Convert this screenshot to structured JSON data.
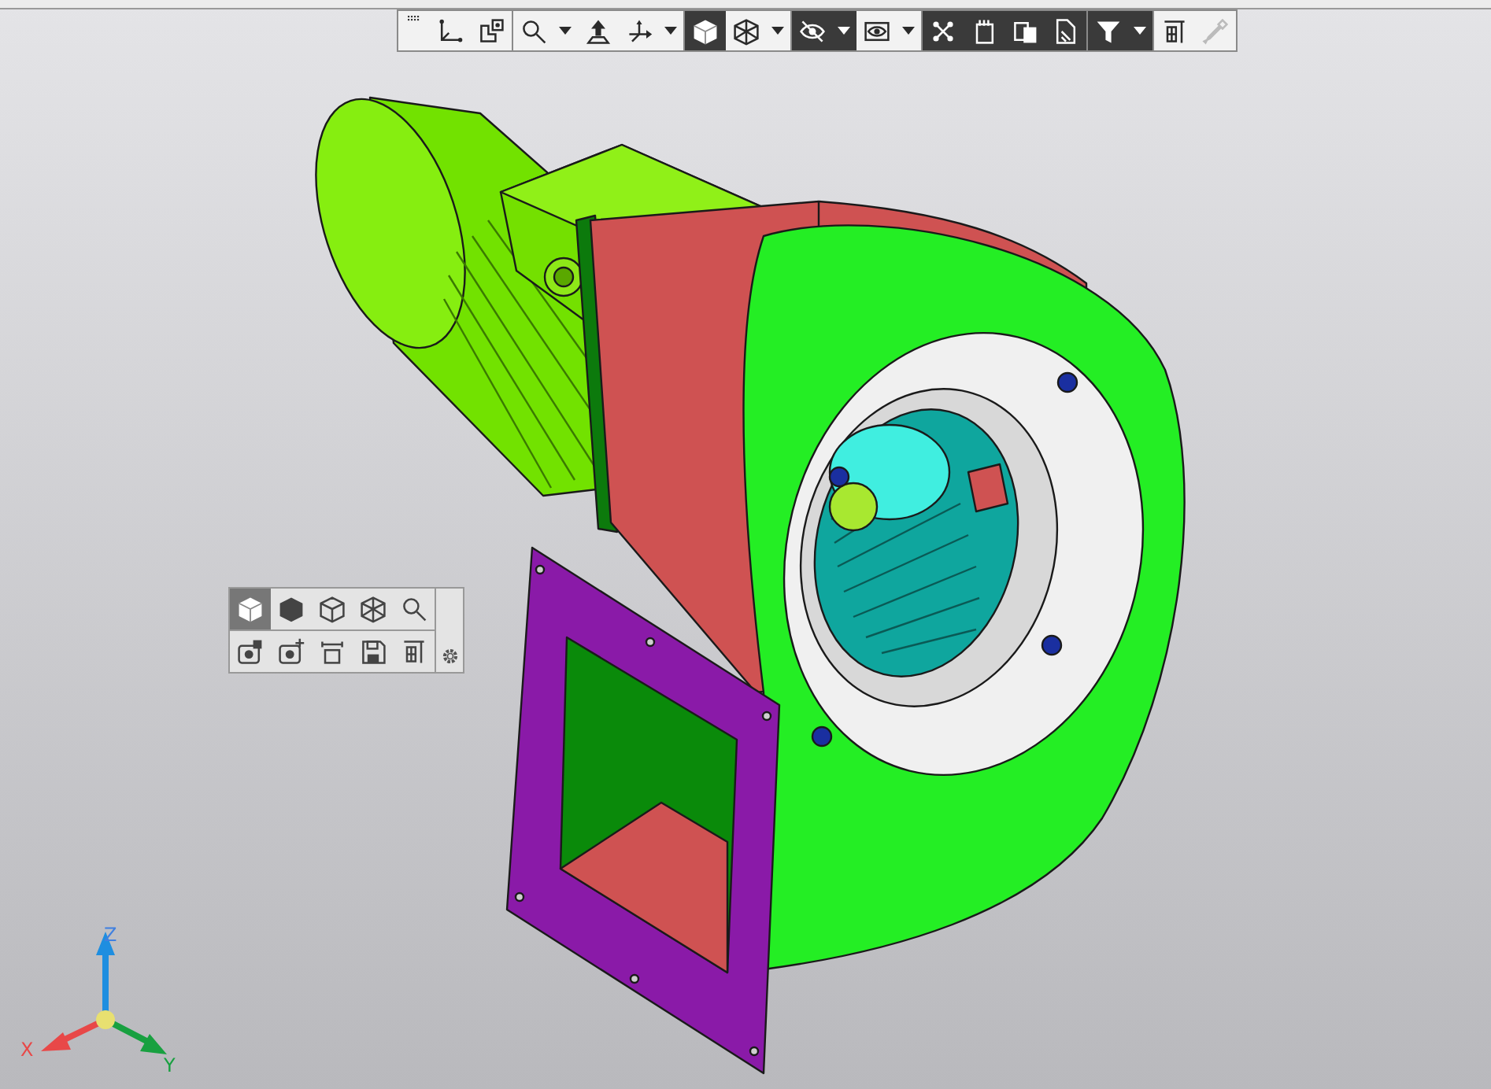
{
  "top_toolbar": {
    "buttons": [
      {
        "selected": false,
        "dropdown": false,
        "disabled": false
      },
      {
        "selected": false,
        "dropdown": false,
        "disabled": false
      },
      {
        "selected": false,
        "dropdown": true,
        "disabled": false
      },
      {
        "selected": false,
        "dropdown": false,
        "disabled": false
      },
      {
        "selected": false,
        "dropdown": true,
        "disabled": false
      },
      {
        "selected": true,
        "dropdown": false,
        "disabled": false
      },
      {
        "selected": false,
        "dropdown": true,
        "disabled": false
      },
      {
        "selected": true,
        "dropdown": true,
        "disabled": false
      },
      {
        "selected": false,
        "dropdown": true,
        "disabled": false
      },
      {
        "selected": true,
        "dropdown": false,
        "disabled": false
      },
      {
        "selected": true,
        "dropdown": false,
        "disabled": false
      },
      {
        "selected": true,
        "dropdown": false,
        "disabled": false
      },
      {
        "selected": true,
        "dropdown": false,
        "disabled": false
      },
      {
        "selected": true,
        "dropdown": true,
        "disabled": false
      },
      {
        "selected": false,
        "dropdown": false,
        "disabled": false
      },
      {
        "selected": false,
        "dropdown": false,
        "disabled": true
      }
    ]
  },
  "view_panel": {
    "rows": [
      {
        "buttons": [
          {
            "selected": true
          },
          {
            "selected": false
          },
          {
            "selected": false
          },
          {
            "selected": false
          },
          {
            "selected": false
          }
        ]
      },
      {
        "buttons": [
          {
            "selected": false
          },
          {
            "selected": false
          },
          {
            "selected": false
          },
          {
            "selected": false
          },
          {
            "selected": false
          }
        ]
      }
    ]
  },
  "axis_triad": {
    "x_label": "X",
    "y_label": "Y",
    "z_label": "Z"
  }
}
